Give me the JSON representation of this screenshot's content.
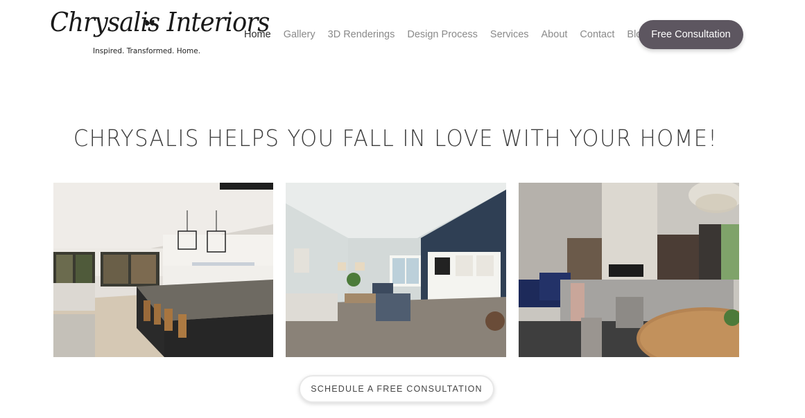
{
  "brand": {
    "logo_text": "Chrysalis Interiors",
    "tagline": "Inspired. Transformed. Home."
  },
  "nav": {
    "items": [
      {
        "label": "Home",
        "active": true
      },
      {
        "label": "Gallery",
        "active": false
      },
      {
        "label": "3D Renderings",
        "active": false
      },
      {
        "label": "Design Process",
        "active": false
      },
      {
        "label": "Services",
        "active": false
      },
      {
        "label": "About",
        "active": false
      },
      {
        "label": "Contact",
        "active": false
      },
      {
        "label": "Blog",
        "active": false
      }
    ],
    "cta_label": "Free Consultation"
  },
  "hero": {
    "headline": "CHRYSALIS HELPS YOU FALL IN LOVE WITH YOUR HOME!"
  },
  "cta": {
    "bottom_label": "SCHEDULE A FREE CONSULTATION"
  },
  "colors": {
    "accent": "#5d5660",
    "nav_text": "#8a8a8a",
    "nav_active": "#2b2b2b",
    "headline": "#3d3d3d"
  }
}
